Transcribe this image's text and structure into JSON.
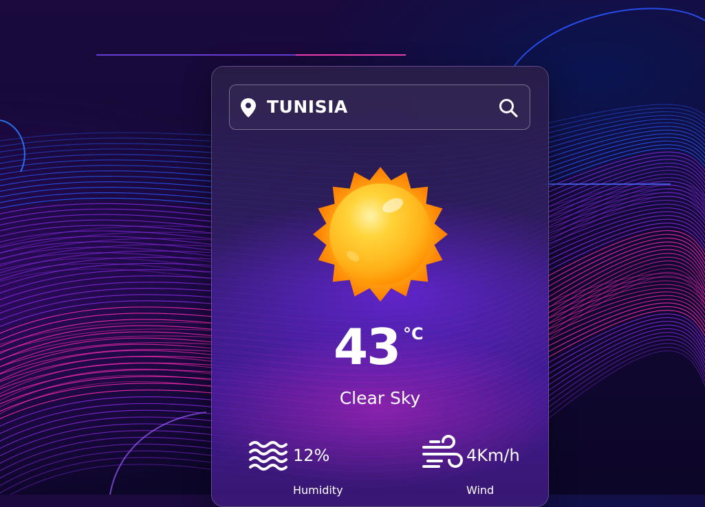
{
  "search": {
    "location": "TUNISIA",
    "location_icon": "map-pin-icon",
    "search_icon": "search-icon"
  },
  "weather": {
    "icon": "sun-icon",
    "temperature": "43",
    "unit": "°C",
    "condition": "Clear Sky"
  },
  "stats": {
    "humidity": {
      "icon": "waves-icon",
      "value": "12%",
      "label": "Humidity"
    },
    "wind": {
      "icon": "wind-icon",
      "value": "4Km/h",
      "label": "Wind"
    }
  },
  "colors": {
    "sun_core": "#ffc21a",
    "sun_rays": "#ff8a00",
    "background": "#120833",
    "wave_pink": "#ff2db4",
    "wave_purple": "#8a2be2",
    "wave_blue": "#2a5cff"
  }
}
